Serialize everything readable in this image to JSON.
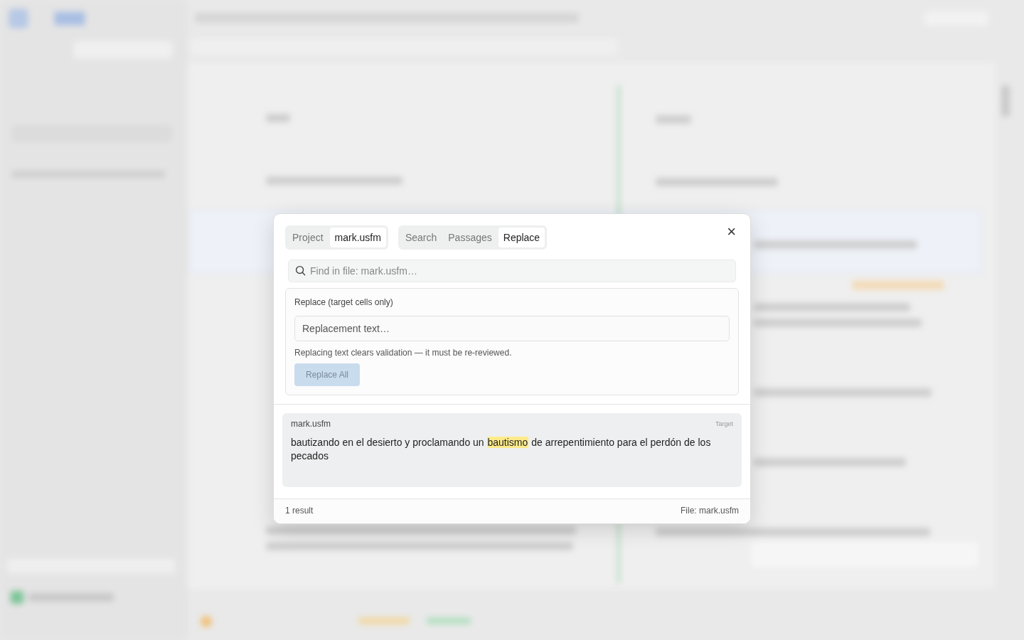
{
  "dialog": {
    "scope_tabs": [
      {
        "label": "Project",
        "selected": false
      },
      {
        "label": "mark.usfm",
        "selected": true
      }
    ],
    "mode_tabs": [
      {
        "label": "Search",
        "selected": false
      },
      {
        "label": "Passages",
        "selected": false
      },
      {
        "label": "Replace",
        "selected": true
      }
    ],
    "close": "×",
    "search": {
      "placeholder": "Find in file: mark.usfm…"
    },
    "replace_panel": {
      "title": "Replace (target cells only)",
      "placeholder": "Replacement text…",
      "warning": "Replacing text clears validation — it must be re-reviewed.",
      "button": {
        "label": "Replace All",
        "disabled": true
      }
    },
    "results": [
      {
        "file": "mark.usfm",
        "tag": "Target",
        "before": "bautizando en el desierto y proclamando un ",
        "match": "bautismo",
        "after": " de arrepentimiento para el perdón de los pecados"
      }
    ],
    "footer": {
      "count": "1 result",
      "file": "File: mark.usfm"
    }
  }
}
